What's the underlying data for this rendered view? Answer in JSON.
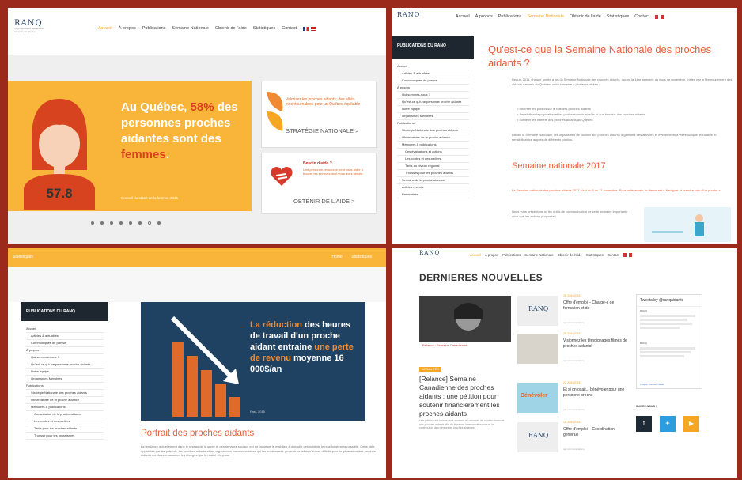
{
  "nav": [
    "Accueil",
    "À propos",
    "Publications",
    "Semaine Nationale",
    "Obtenir de l'aide",
    "Statistiques",
    "Contact"
  ],
  "logo": {
    "name": "RANQ",
    "tagline": "Regroupement des aidants naturels du Québec"
  },
  "panel1": {
    "active": "Accueil",
    "hero_line1": "Au Québec, ",
    "hero_pct": "58%",
    "hero_line2": " des personnes proches aidantes sont des ",
    "hero_women": "femmes",
    "hero_dot": ".",
    "hero_number": "57.8",
    "hero_source": "Conseil du statut de la femme, 2015",
    "card1_text": "Valoriser les proches aidants, des alliés incontournables pour un Québec équitable",
    "card1_cta": "STRATÉGIE NATIONALE >",
    "card2_title": "Besoin d'aide ?",
    "card2_text": "Une personne-ressource peut vous aider à trouver les services dont vous avez besoin.",
    "card2_cta": "OBTENIR DE L'AIDE >"
  },
  "panel2": {
    "active": "Semaine Nationale",
    "sidebar_title": "PUBLICATIONS DU RANQ",
    "sidebar_items": [
      "Accueil",
      "Articles & actualités",
      "Communiqués de presse",
      "À propos",
      "Qui sommes-nous ?",
      "Qu'est-ce qu'une personne proche aidante",
      "Notre équipe",
      "Organismes Membres",
      "Publications",
      "Stratégie Nationale des proches aidants",
      "Observatoire de la proche aidance",
      "Mémoires & publications",
      "Ces évaluations et actions",
      "Les contes et des ateliers",
      "Tarifs au niveau régional",
      "Trousses pour les proches aidants",
      "Semaine de la proche aidance",
      "Articles récents",
      "Partenaires"
    ],
    "title": "Qu'est-ce que la Semaine Nationale des proches aidants ?",
    "para1": "Depuis 2011, chaque année à lieu la Semaine Nationale des proches aidants, durant la 1ère semaine du mois de novembre. Initiée par le Regroupement des aidants naturels du Québec, cette semaine a plusieurs visées :",
    "bullets": [
      "Informer les publics sur le rôle des proches aidants",
      "Sensibiliser la population et les professionnels au rôle et aux besoins des proches aidants",
      "Soutenir les intérêts des proches aidants au Québec"
    ],
    "para2": "Durant la Semaine Nationale, les organismes de soutien aux proches aidants organisent des activités et événements à visée ludique, éducative et sensibilisatrice auprès de différents publics.",
    "h2": "Semaine nationale 2017",
    "para3": "La Semaine nationale des proches aidants 2017 s'est du 5 au 11 novembre. Pour cette année, le thème est « Naviguer et prendre soin d'un proche ».",
    "para4": "Nous vous présentons ici les outils de communication de cette semaine importante ainsi que les actions proposées."
  },
  "panel3": {
    "topbar_title": "Statistiques",
    "breadcrumb": [
      "Home",
      "Statistiques"
    ],
    "sidebar_title": "PUBLICATIONS DU RANQ",
    "sidebar_items": [
      "Accueil",
      "Articles & actualités",
      "Communiqués de presse",
      "À propos",
      "Qui sommes-nous ?",
      "Qu'est-ce qu'une personne proche aidante",
      "Notre équipe",
      "Organismes Membres",
      "Publications",
      "Stratégie Nationale des proches aidants",
      "Observatoire de la proche aidance",
      "Mémoires & publications",
      "Consultation de la proche aidance",
      "Les contes et des ateliers",
      "Tarifs pour les proches aidants",
      "Trousse pour les organismes"
    ],
    "info_pre": "La réduction",
    "info_mid1": " des heures de travail d'un proche aidant entraine ",
    "info_hl": "une perte de revenu",
    "info_mid2": " moyenne 16 000$/an",
    "info_src": "Fast, 2015",
    "h2": "Portrait des proches aidants",
    "para": "La tendance actuellement dans le réseau de la santé et des services sociaux est de favoriser le maintien à domicile des patients le plus longtemps possible. Cette idée, appréciée par les patients, les proches aidants et les organismes communautaires qui les soutiennent, pourrait toutefois s'avérer difficile pour la génération des proches aidants qui doivent assumer les charges que la réalité s'impose."
  },
  "panel4": {
    "active": "Accueil",
    "h1": "DERNIERES NOUVELLES",
    "highlight_caption": "Relance : Semaine Canadienne",
    "highlight_badge": "ACTUALITÉS",
    "highlight_title": "[Relance] Semaine Canadienne des proches aidants : une pétition pour soutenir financièrement les proches aidants",
    "highlight_text": "Une pétition est lancée pour soutenir les services de soutien financier aux proches aidants afin de favoriser la reconnaissance et la contribution des personnes proches aidantes.",
    "news": [
      {
        "date": "26 JUIN 2018",
        "title": "Offre d'emploi – Chargé-e de formation et de",
        "meta": "par communications"
      },
      {
        "date": "26 JUIN 2018",
        "title": "Visionnez les témoignages filmés de proches aidants!",
        "meta": "par communications"
      },
      {
        "date": "22 JUIN 2018",
        "title": "Et si on osait... bénévoler pour une personne proche",
        "meta": "par communications"
      },
      {
        "date": "15 JUIN 2018",
        "title": "Offre d'emploi – Coordination générale",
        "meta": "par communications"
      }
    ],
    "twitter_head": "Tweets by @ranqaidants",
    "twitter_user": "RANQ",
    "twitter_footer": "Intégrer    Voir sur Twitter",
    "social_label": "SUIVEZ-NOUS !",
    "thumb_volunteer": "Bénévoler",
    "colors": {
      "facebook": "#1e2a36",
      "twitter": "#2d9de0",
      "youtube": "#f5a623"
    }
  },
  "colors": {
    "accent": "#f8b53a",
    "title_red": "#e85e3c",
    "dark_navy": "#1f4263",
    "frame": "#9b2a1c"
  }
}
